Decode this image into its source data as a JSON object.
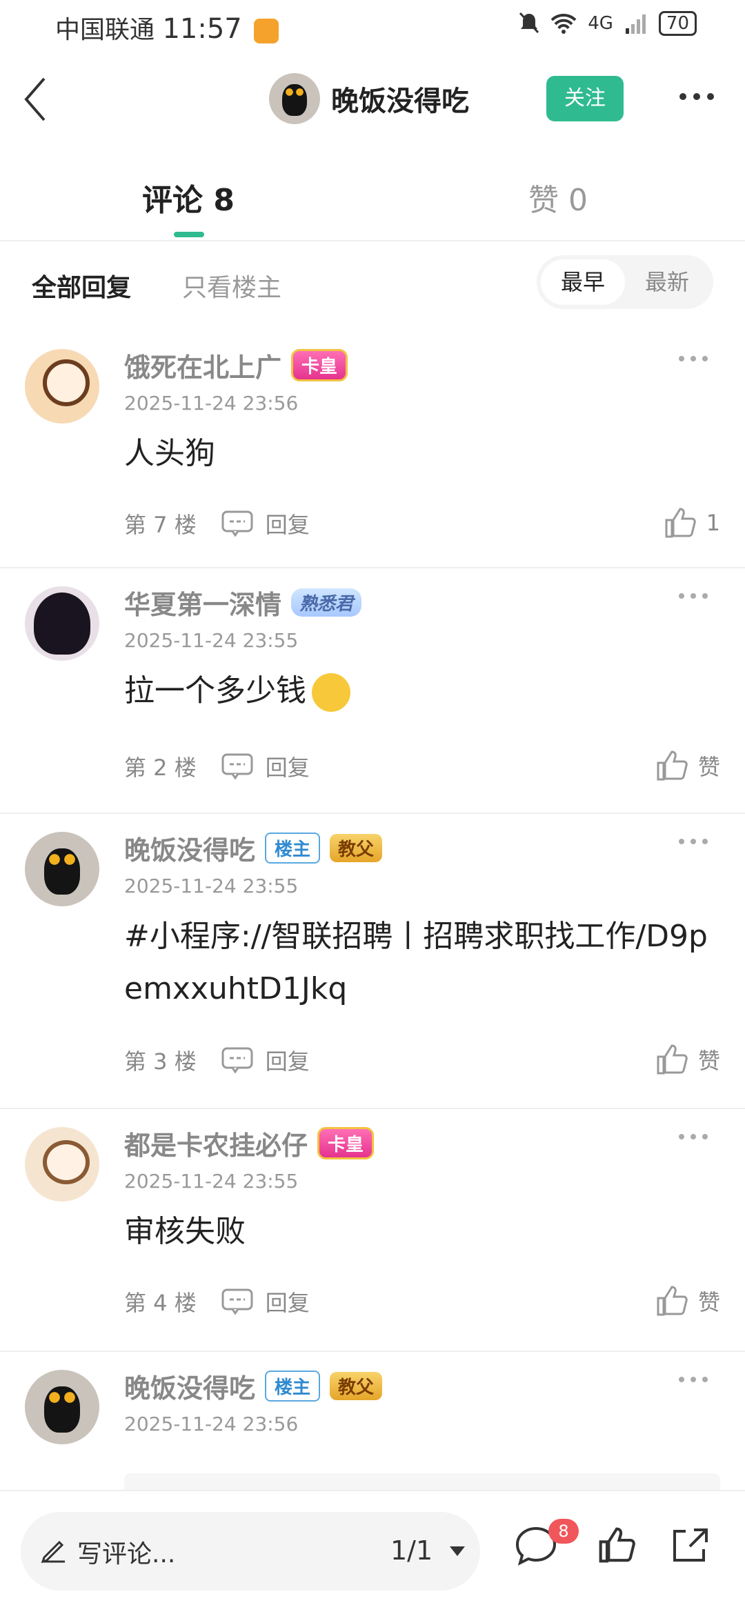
{
  "status_bar": {
    "carrier": "中国联通",
    "time": "11:57",
    "network": "4G",
    "battery": "70"
  },
  "header": {
    "username": "晚饭没得吃",
    "follow_label": "关注"
  },
  "tabs": [
    {
      "label": "评论 8"
    },
    {
      "label": "赞 0"
    }
  ],
  "filters": {
    "all_replies": "全部回复",
    "op_only": "只看楼主",
    "sort_earliest": "最早",
    "sort_latest": "最新"
  },
  "comments": [
    {
      "name": "饿死在北上广",
      "badge": "卡皇",
      "time": "2025-11-24 23:56",
      "text": "人头狗",
      "floor": "第 7 楼",
      "reply": "回复",
      "likes": "1"
    },
    {
      "name": "华夏第一深情",
      "badge": "熟悉君",
      "time": "2025-11-24 23:55",
      "text": "拉一个多少钱",
      "floor": "第 2 楼",
      "reply": "回复",
      "likes": "赞"
    },
    {
      "name": "晚饭没得吃",
      "op_tag": "楼主",
      "badge": "教父",
      "time": "2025-11-24 23:55",
      "text": "#小程序://智联招聘丨招聘求职找工作/D9pemxxuhtD1Jkq",
      "floor": "第 3 楼",
      "reply": "回复",
      "likes": "赞"
    },
    {
      "name": "都是卡农挂必仔",
      "badge": "卡皇",
      "time": "2025-11-24 23:55",
      "text": "审核失败",
      "floor": "第 4 楼",
      "reply": "回复",
      "likes": "赞"
    },
    {
      "name": "晚饭没得吃",
      "op_tag": "楼主",
      "badge": "教父",
      "time": "2025-11-24 23:56"
    }
  ],
  "bottom_bar": {
    "write_placeholder": "写评论...",
    "page": "1/1",
    "comment_count": "8"
  },
  "colors": {
    "accent": "#2fbb8f",
    "badge_red": "#f0565a"
  }
}
